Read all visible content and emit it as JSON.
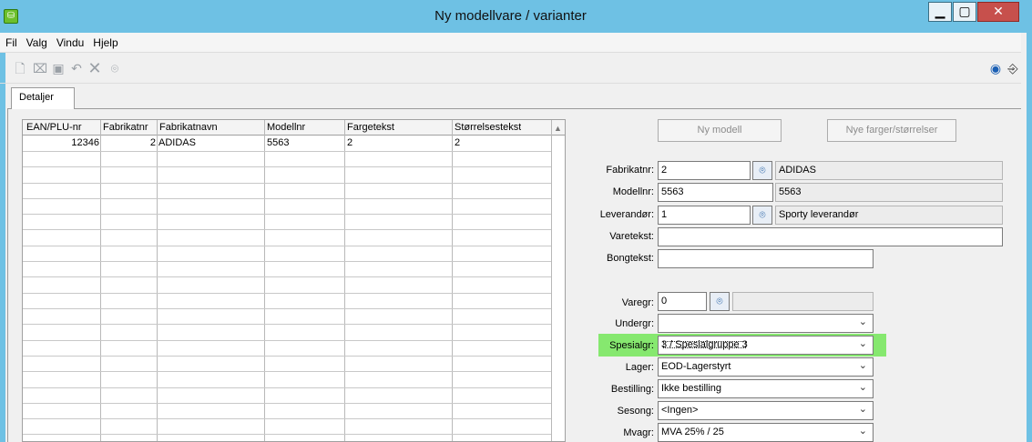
{
  "window": {
    "title": "Ny modellvare / varianter",
    "icon": "cart-icon",
    "controls": [
      "minimize-icon",
      "maximize-icon",
      "close-icon"
    ]
  },
  "menu": [
    "Fil",
    "Valg",
    "Vindu",
    "Hjelp"
  ],
  "toolbar": {
    "icons": [
      "new-document-icon",
      "delete-icon",
      "save-icon",
      "undo-icon",
      "cancel-icon",
      "binoculars-icon"
    ],
    "right_icons": [
      "help-icon",
      "exit-door-icon"
    ]
  },
  "tab": {
    "label": "Detaljer"
  },
  "grid": {
    "columns": [
      "EAN/PLU-nr",
      "Fabrikatnr",
      "Fabrikatnavn",
      "Modellnr",
      "Fargetekst",
      "Størrelsestekst"
    ],
    "rows": [
      [
        "12346",
        "2",
        "ADIDAS",
        "5563",
        "2",
        "2"
      ]
    ]
  },
  "buttons": {
    "ny_modell": "Ny modell",
    "nye_farger": "Nye farger/størrelser"
  },
  "form": {
    "fabrikatnr": {
      "label": "Fabrikatnr:",
      "value": "2",
      "name": "ADIDAS"
    },
    "modellnr": {
      "label": "Modellnr:",
      "value": "5563",
      "display": "5563"
    },
    "leverandor": {
      "label": "Leverandør:",
      "value": "1",
      "name": "Sporty leverandør"
    },
    "varetekst": {
      "label": "Varetekst:",
      "value": ""
    },
    "bongtekst": {
      "label": "Bongtekst:",
      "value": ""
    },
    "varegr": {
      "label": "Varegr:",
      "value": "0",
      "name": ""
    },
    "undergr": {
      "label": "Undergr:",
      "value": ""
    },
    "spesialgr": {
      "label": "Spesialgr:",
      "value": "3 / Spesialgruppe 3"
    },
    "lager": {
      "label": "Lager:",
      "value": "EOD-Lagerstyrt"
    },
    "bestilling": {
      "label": "Bestilling:",
      "value": "Ikke bestilling"
    },
    "sesong": {
      "label": "Sesong:",
      "value": "<Ingen>"
    },
    "mvagr": {
      "label": "Mvagr:",
      "value": "MVA 25% / 25"
    }
  },
  "colors": {
    "titlebar": "#6ec1e4",
    "highlight": "#86e86f",
    "close": "#c7504c"
  }
}
